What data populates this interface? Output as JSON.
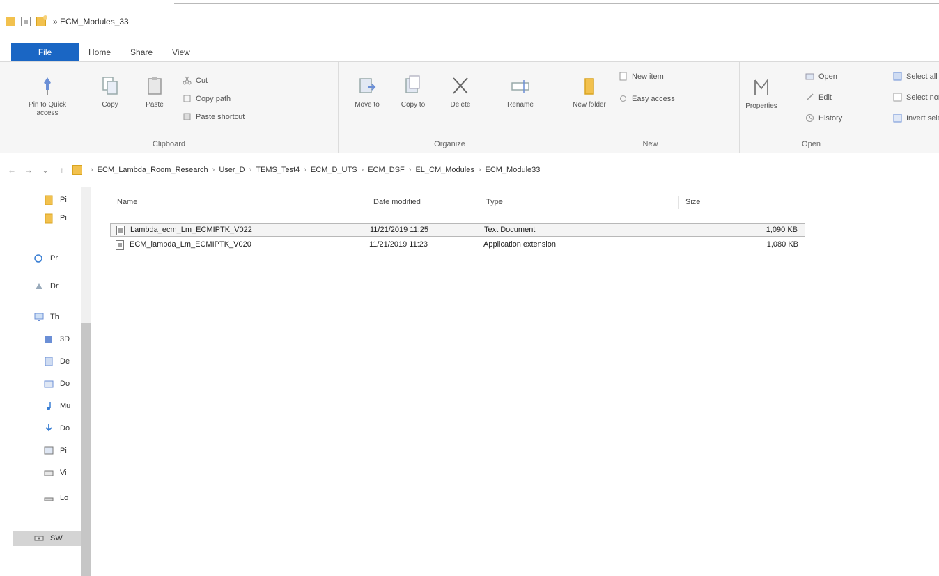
{
  "window": {
    "title": "» ECM_Modules_33"
  },
  "tabs": [
    {
      "label": "File"
    },
    {
      "label": "Home"
    },
    {
      "label": "Share"
    },
    {
      "label": "View"
    }
  ],
  "ribbon": {
    "clipboard": {
      "label": "Clipboard",
      "pin_label": "Pin to Quick access",
      "copy_label": "Copy",
      "paste_label": "Paste",
      "cut_label": "Cut",
      "copy_path_label": "Copy path",
      "paste_shortcut_label": "Paste shortcut"
    },
    "organize": {
      "label": "Organize",
      "move_to_label": "Move to",
      "copy_to_label": "Copy to",
      "delete_label": "Delete",
      "rename_label": "Rename"
    },
    "new": {
      "label": "New",
      "new_folder_label": "New folder",
      "new_item_label": "New item",
      "easy_access_label": "Easy access"
    },
    "open": {
      "label": "Open",
      "properties_label": "Properties",
      "open_label": "Open",
      "edit_label": "Edit",
      "history_label": "History"
    },
    "select": {
      "select_all_label": "Select all",
      "select_none_label": "Select none",
      "invert_label": "Invert selection"
    }
  },
  "address": {
    "back": "←",
    "forward": "→",
    "recent": "⌄",
    "up": "↑",
    "crumbs": [
      "ECM_Lambda_Room_Research",
      "User_D",
      "TEMS_Test4",
      "ECM_D_UTS",
      "ECM_DSF",
      "EL_CM_Modules",
      "ECM_Module33"
    ]
  },
  "navpane": {
    "items": [
      {
        "label": "Pi",
        "icon": "folder-icon"
      },
      {
        "label": "Pi",
        "icon": "folder-icon"
      },
      {
        "label": "Pr",
        "icon": "onedrive-icon"
      },
      {
        "label": "Dr",
        "icon": "network-icon"
      },
      {
        "label": "Th",
        "icon": "computer-icon"
      },
      {
        "label": "3D",
        "icon": "3d-objects-icon"
      },
      {
        "label": "De",
        "icon": "desktop-icon"
      },
      {
        "label": "Do",
        "icon": "documents-icon"
      },
      {
        "label": "Mu",
        "icon": "music-icon"
      },
      {
        "label": "Do",
        "icon": "downloads-icon"
      },
      {
        "label": "Pi",
        "icon": "pictures-icon"
      },
      {
        "label": "Vi",
        "icon": "videos-icon"
      },
      {
        "label": "Lo",
        "icon": "drive-icon"
      },
      {
        "label": "SW",
        "icon": "network-drive-icon"
      }
    ]
  },
  "filelist": {
    "columns": {
      "name": "Name",
      "modified": "Date modified",
      "type": "Type",
      "size": "Size"
    },
    "rows": [
      {
        "name": "Lambda_ecm_Lm_ECMIPTK_V022",
        "modified": "11/21/2019 11:25",
        "type": "Text Document",
        "size": "1,090 KB"
      },
      {
        "name": "ECM_lambda_Lm_ECMIPTK_V020",
        "modified": "11/21/2019 11:23",
        "type": "Application extension",
        "size": "1,080 KB"
      }
    ]
  }
}
